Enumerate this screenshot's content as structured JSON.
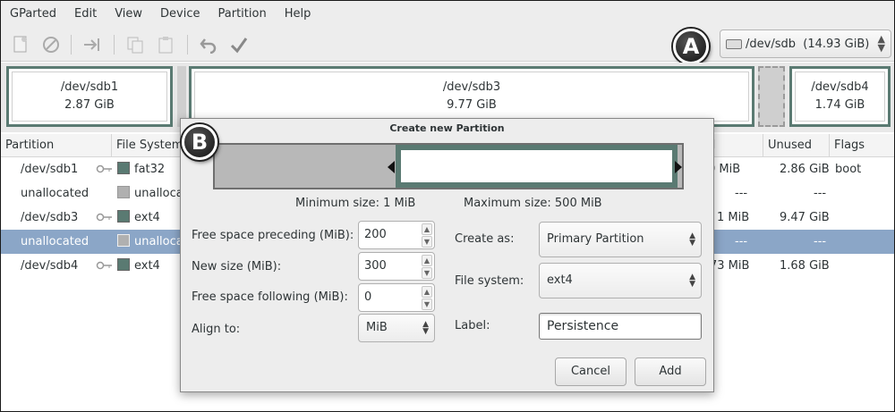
{
  "menubar": {
    "items": [
      "GParted",
      "Edit",
      "View",
      "Device",
      "Partition",
      "Help"
    ]
  },
  "toolbar": {
    "icons": [
      "new-icon",
      "delete-icon",
      "resize-move-icon",
      "copy-icon",
      "paste-icon",
      "undo-icon",
      "apply-icon"
    ]
  },
  "device_selector": {
    "value": "/dev/sdb  (14.93 GiB)"
  },
  "badges": {
    "a": "A",
    "b": "B"
  },
  "disk_map": {
    "partitions": [
      {
        "name": "/dev/sdb1",
        "size": "2.87 GiB"
      },
      {
        "name": "/dev/sdb3",
        "size": "9.77 GiB"
      },
      {
        "name": "/dev/sdb4",
        "size": "1.74 GiB"
      }
    ]
  },
  "table": {
    "headers": {
      "partition": "Partition",
      "filesystem": "File System",
      "used": "d",
      "unused": "Unused",
      "flags": "Flags"
    },
    "rows": [
      {
        "partition": "/dev/sdb1",
        "fs": "fat32",
        "used": "0 MiB",
        "unused": "2.86 GiB",
        "flags": "boot",
        "color": "#5a7a72",
        "locked": true
      },
      {
        "partition": "unallocated",
        "fs": "unalloca",
        "used": "---",
        "unused": "---",
        "flags": "",
        "color": "#b0b0b0",
        "locked": false
      },
      {
        "partition": "/dev/sdb3",
        "fs": "ext4",
        "used": "1 MiB",
        "unused": "9.47 GiB",
        "flags": "",
        "color": "#5a7a72",
        "locked": true
      },
      {
        "partition": "unallocated",
        "fs": "unalloca",
        "used": "---",
        "unused": "---",
        "flags": "",
        "color": "#b0b0b0",
        "locked": false,
        "selected": true
      },
      {
        "partition": "/dev/sdb4",
        "fs": "ext4",
        "used": "73 MiB",
        "unused": "1.68 GiB",
        "flags": "",
        "color": "#5a7a72",
        "locked": true
      }
    ]
  },
  "dialog": {
    "title": "Create new Partition",
    "min_size": "Minimum size: 1 MiB",
    "max_size": "Maximum size: 500 MiB",
    "free_preceding_label": "Free space preceding (MiB):",
    "free_preceding_value": "200",
    "new_size_label": "New size (MiB):",
    "new_size_value": "300",
    "free_following_label": "Free space following (MiB):",
    "free_following_value": "0",
    "align_label": "Align to:",
    "align_value": "MiB",
    "create_as_label": "Create as:",
    "create_as_value": "Primary Partition",
    "filesystem_label": "File system:",
    "filesystem_value": "ext4",
    "label_label": "Label:",
    "label_value": "Persistence",
    "cancel": "Cancel",
    "add": "Add"
  },
  "colors": {
    "partition_border": "#5a7a72",
    "selection": "#8ba6c7"
  }
}
